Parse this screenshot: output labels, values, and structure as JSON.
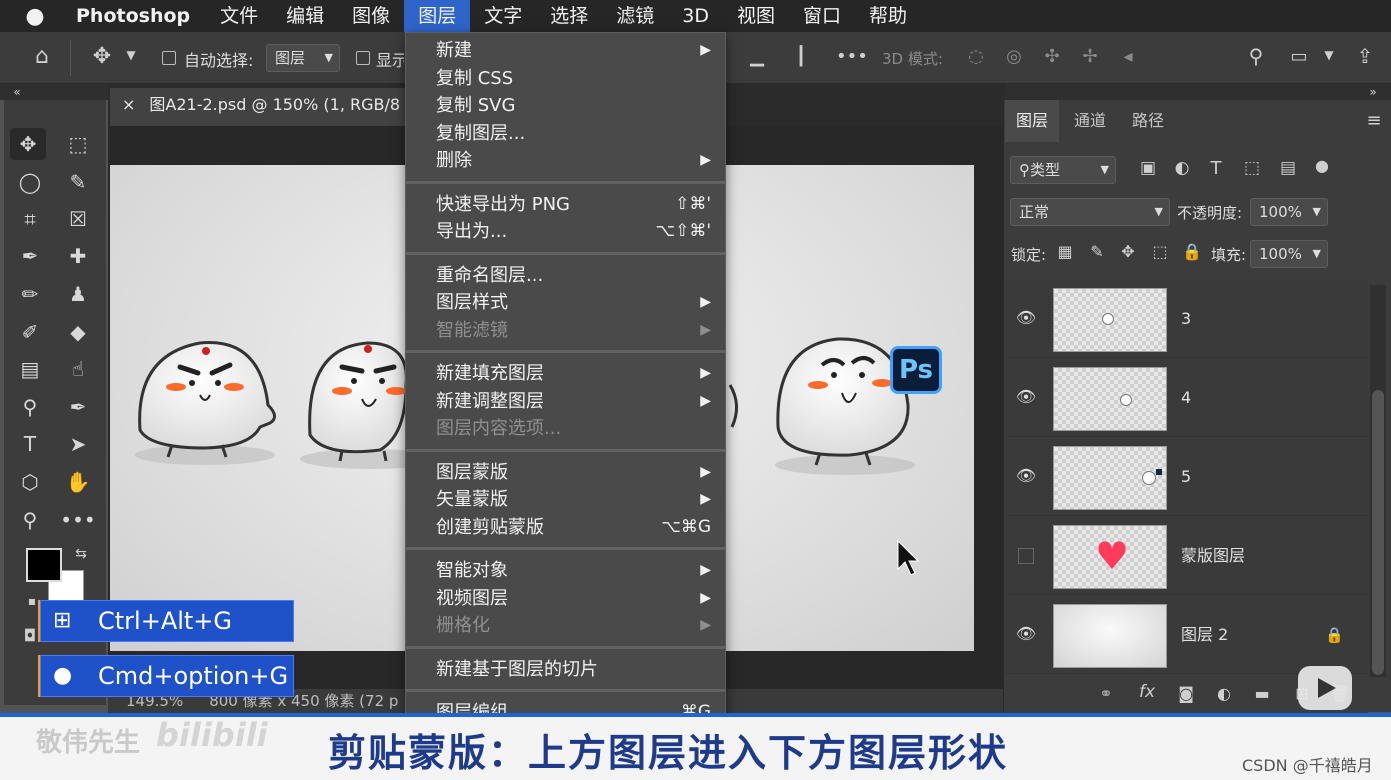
{
  "menubar": {
    "apple": "",
    "app": "Photoshop",
    "items": [
      "文件",
      "编辑",
      "图像",
      "图层",
      "文字",
      "选择",
      "滤镜",
      "3D",
      "视图",
      "窗口",
      "帮助"
    ]
  },
  "options": {
    "auto_select_label": "自动选择:",
    "auto_select_value": "图层",
    "show_label": "显示",
    "mode_3d": "3D 模式:"
  },
  "document": {
    "tab_title": "图A21-2.psd @ 150% (1, RGB/8",
    "zoom": "149.5%",
    "size": "800 像素 x 450 像素 (72 p"
  },
  "layer_menu": {
    "groups": [
      [
        {
          "label": "新建",
          "submenu": true
        },
        {
          "label": "复制 CSS"
        },
        {
          "label": "复制 SVG"
        },
        {
          "label": "复制图层..."
        },
        {
          "label": "删除",
          "submenu": true
        }
      ],
      [
        {
          "label": "快速导出为 PNG",
          "shortcut": "⇧⌘'"
        },
        {
          "label": "导出为...",
          "shortcut": "⌥⇧⌘'"
        }
      ],
      [
        {
          "label": "重命名图层..."
        },
        {
          "label": "图层样式",
          "submenu": true
        },
        {
          "label": "智能滤镜",
          "submenu": true,
          "disabled": true
        }
      ],
      [
        {
          "label": "新建填充图层",
          "submenu": true
        },
        {
          "label": "新建调整图层",
          "submenu": true
        },
        {
          "label": "图层内容选项...",
          "disabled": true
        }
      ],
      [
        {
          "label": "图层蒙版",
          "submenu": true
        },
        {
          "label": "矢量蒙版",
          "submenu": true
        },
        {
          "label": "创建剪贴蒙版",
          "shortcut": "⌥⌘G"
        }
      ],
      [
        {
          "label": "智能对象",
          "submenu": true
        },
        {
          "label": "视频图层",
          "submenu": true
        },
        {
          "label": "栅格化",
          "submenu": true,
          "disabled": true
        }
      ],
      [
        {
          "label": "新建基于图层的切片"
        }
      ],
      [
        {
          "label": "图层编组",
          "shortcut": "⌘G"
        }
      ]
    ]
  },
  "panel": {
    "tabs": [
      "图层",
      "通道",
      "路径"
    ],
    "filter": "类型",
    "blend_mode": "正常",
    "opacity_label": "不透明度:",
    "opacity": "100%",
    "lock_label": "锁定:",
    "fill_label": "填充:",
    "fill": "100%",
    "layers": [
      {
        "name": "3",
        "visible": true
      },
      {
        "name": "4",
        "visible": true
      },
      {
        "name": "5",
        "visible": true
      },
      {
        "name": "蒙版图层",
        "visible": false
      },
      {
        "name": "图层 2",
        "visible": true,
        "locked": true
      }
    ]
  },
  "overlay": {
    "win_shortcut": "Ctrl+Alt+G",
    "mac_shortcut": "Cmd+option+G",
    "subtitle": "剪贴蒙版：上方图层进入下方图层形状",
    "watermark_name": "敬伟先生",
    "watermark_site": "bilibili",
    "csdn": "CSDN @千禧皓月",
    "ps_badge": "Ps"
  }
}
